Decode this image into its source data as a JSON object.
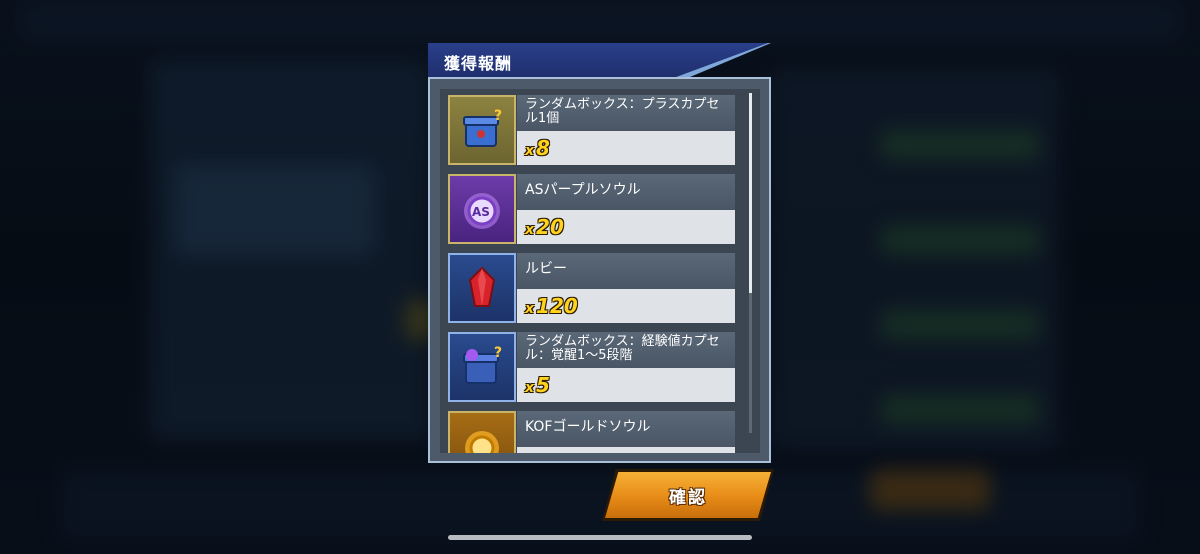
{
  "dialog": {
    "title": "獲得報酬",
    "items": [
      {
        "name": "ランダムボックス：プラスカプセル1個",
        "qty_prefix": "x",
        "qty": "8",
        "icon": "box-capsule-icon"
      },
      {
        "name": "ASパープルソウル",
        "qty_prefix": "x",
        "qty": "20",
        "icon": "purple-soul-icon"
      },
      {
        "name": "ルビー",
        "qty_prefix": "x",
        "qty": "120",
        "icon": "ruby-icon"
      },
      {
        "name": "ランダムボックス：経験値カプセル：覚醒1～5段階",
        "qty_prefix": "x",
        "qty": "5",
        "icon": "box-exp-capsule-icon"
      },
      {
        "name": "KOFゴールドソウル",
        "qty_prefix": "",
        "qty": "",
        "icon": "gold-soul-icon"
      }
    ]
  },
  "confirm_label": "確認",
  "colors": {
    "title_bar": "#1f2f6e",
    "confirm_button": "#e78b17",
    "quantity_text": "#ffd21e"
  }
}
